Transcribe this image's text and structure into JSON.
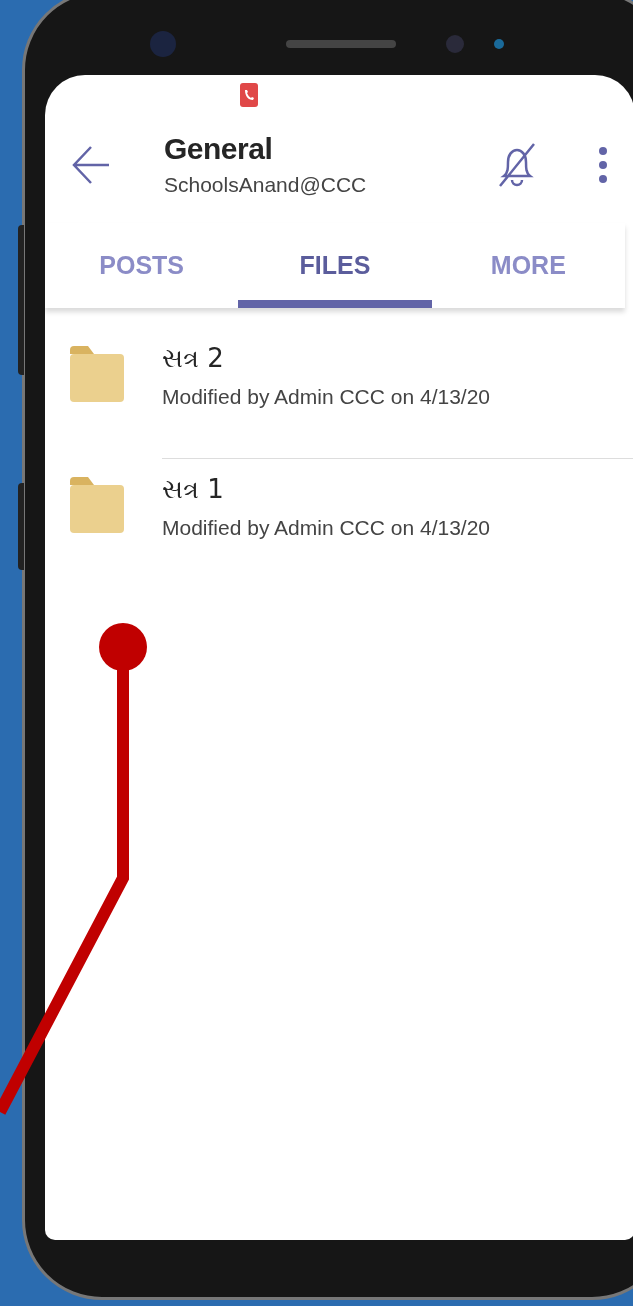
{
  "header": {
    "title": "General",
    "subtitle": "SchoolsAnand@CCC"
  },
  "tabs": [
    {
      "label": "POSTS",
      "selected": false
    },
    {
      "label": "FILES",
      "selected": true
    },
    {
      "label": "MORE",
      "selected": false
    }
  ],
  "files": [
    {
      "name": "સત્ર 2",
      "modified": "Modified by Admin CCC on 4/13/20"
    },
    {
      "name": "સત્ર 1",
      "modified": "Modified by Admin CCC on 4/13/20"
    }
  ]
}
